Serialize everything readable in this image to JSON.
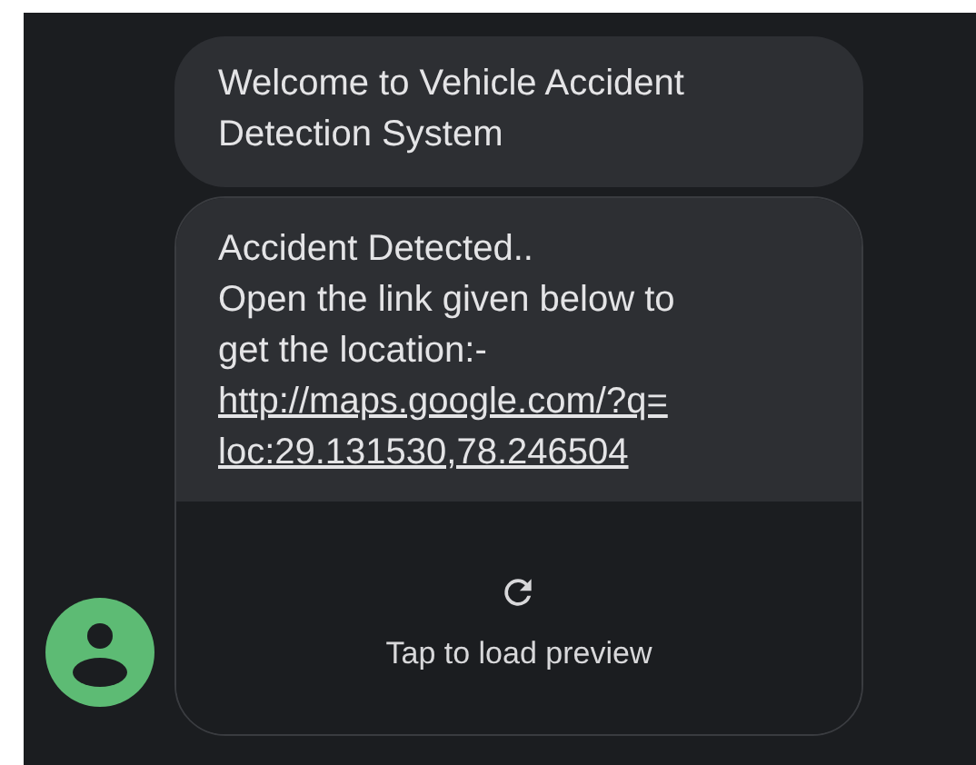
{
  "messages": [
    {
      "kind": "text",
      "text": "Welcome to Vehicle Accident Detection System"
    },
    {
      "kind": "link_preview",
      "text": "Accident Detected..\nOpen the link given below to\nget the location:-",
      "link": "http://maps.google.com/?q=loc:29.131530,78.246504",
      "preview_label": "Tap to load preview"
    }
  ]
}
